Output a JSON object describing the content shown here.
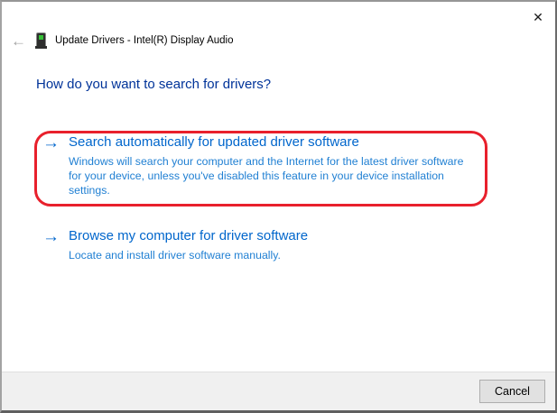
{
  "window": {
    "title": "Update Drivers - Intel(R) Display Audio"
  },
  "icons": {
    "back_arrow": "←",
    "close": "✕",
    "command_arrow": "→",
    "device": "device-tower-green-led"
  },
  "main": {
    "heading": "How do you want to search for drivers?",
    "options": [
      {
        "title": "Search automatically for updated driver software",
        "description": "Windows will search your computer and the Internet for the latest driver software\nfor your device, unless you've disabled this feature in your device installation\nsettings.",
        "highlighted": true
      },
      {
        "title": "Browse my computer for driver software",
        "description": "Locate and install driver software manually.",
        "highlighted": false
      }
    ]
  },
  "footer": {
    "cancel": "Cancel"
  },
  "colors": {
    "heading": "#003399",
    "link": "#0066cc",
    "link-desc": "#2180d3",
    "annotation": "#e8202c",
    "footer-bg": "#f0f0f0"
  }
}
